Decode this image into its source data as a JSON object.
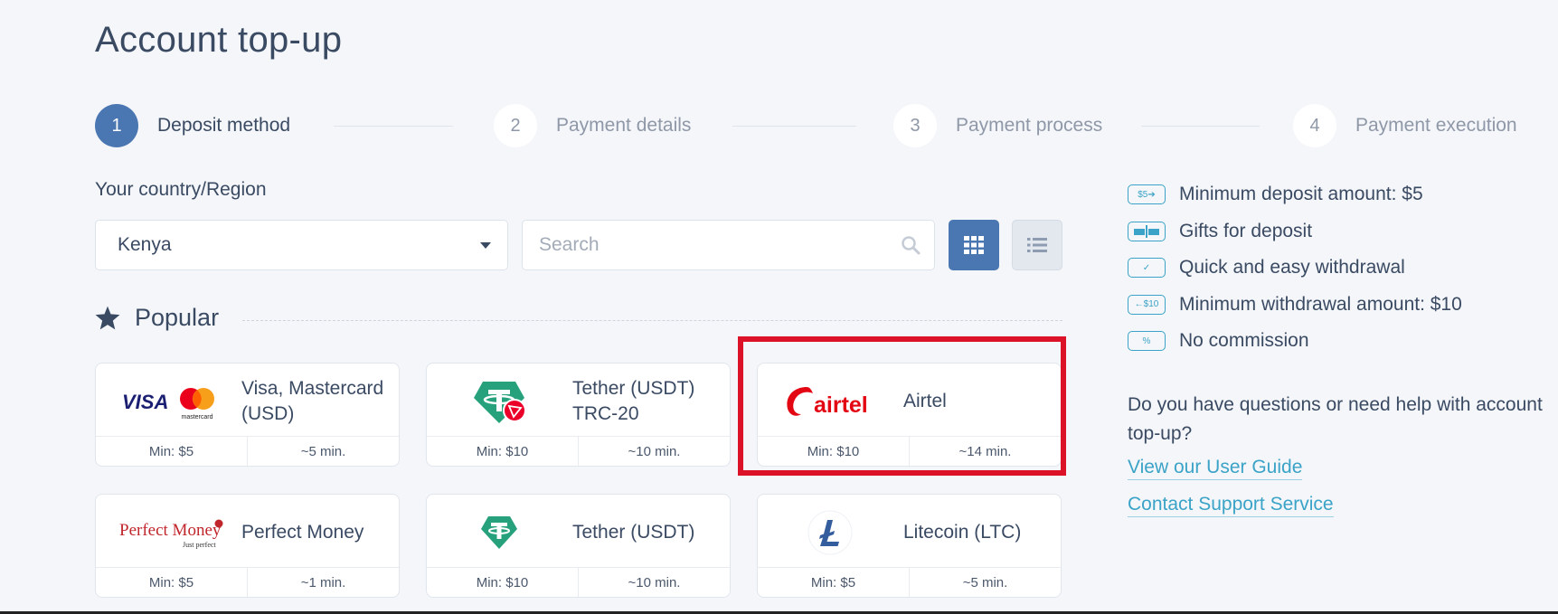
{
  "page": {
    "title": "Account top-up"
  },
  "steps": [
    {
      "number": "1",
      "label": "Deposit method",
      "active": true
    },
    {
      "number": "2",
      "label": "Payment details",
      "active": false
    },
    {
      "number": "3",
      "label": "Payment process",
      "active": false
    },
    {
      "number": "4",
      "label": "Payment execution",
      "active": false
    }
  ],
  "region": {
    "label": "Your country/Region",
    "selected": "Kenya"
  },
  "search": {
    "placeholder": "Search",
    "value": ""
  },
  "view_toggle": {
    "active": "grid"
  },
  "popular": {
    "title": "Popular"
  },
  "methods": [
    {
      "name": "Visa, Mastercard (USD)",
      "min": "Min: $5",
      "time": "~5 min.",
      "logo": "visa-mastercard-logo",
      "logo_text": {
        "visa": "VISA",
        "mastercard": "mastercard"
      }
    },
    {
      "name": "Tether (USDT) TRC-20",
      "min": "Min: $10",
      "time": "~10 min.",
      "logo": "tether-trc20-logo"
    },
    {
      "name": "Airtel",
      "min": "Min: $10",
      "time": "~14 min.",
      "logo": "airtel-logo",
      "logo_text": "airtel",
      "highlighted": true
    },
    {
      "name": "Perfect Money",
      "min": "Min: $5",
      "time": "~1 min.",
      "logo": "perfect-money-logo",
      "logo_text": {
        "main": "Perfect Money",
        "tagline": "Just perfect"
      }
    },
    {
      "name": "Tether (USDT)",
      "min": "Min: $10",
      "time": "~10 min.",
      "logo": "tether-logo"
    },
    {
      "name": "Litecoin (LTC)",
      "min": "Min: $5",
      "time": "~5 min.",
      "logo": "litecoin-logo"
    }
  ],
  "features": [
    {
      "icon": "min-deposit-icon",
      "icon_text": "$5➔",
      "text": "Minimum deposit amount: $5"
    },
    {
      "icon": "gift-icon",
      "icon_text": "",
      "text": "Gifts for deposit"
    },
    {
      "icon": "check-icon",
      "icon_text": "✓",
      "text": "Quick and easy withdrawal"
    },
    {
      "icon": "min-withdrawal-icon",
      "icon_text": "←$10",
      "text": "Minimum withdrawal amount: $10"
    },
    {
      "icon": "percent-icon",
      "icon_text": "%",
      "text": "No commission"
    }
  ],
  "help": {
    "question": "Do you have questions or need help with account top-up?",
    "guide_link": "View our User Guide",
    "support_link": "Contact Support Service"
  },
  "colors": {
    "background": "#f4f6f9",
    "accent": "#4a77b2",
    "link": "#3aa3c7",
    "highlight": "#dc1228",
    "tether": "#26a17b",
    "airtel": "#e30613",
    "text": "#3a4a63"
  }
}
